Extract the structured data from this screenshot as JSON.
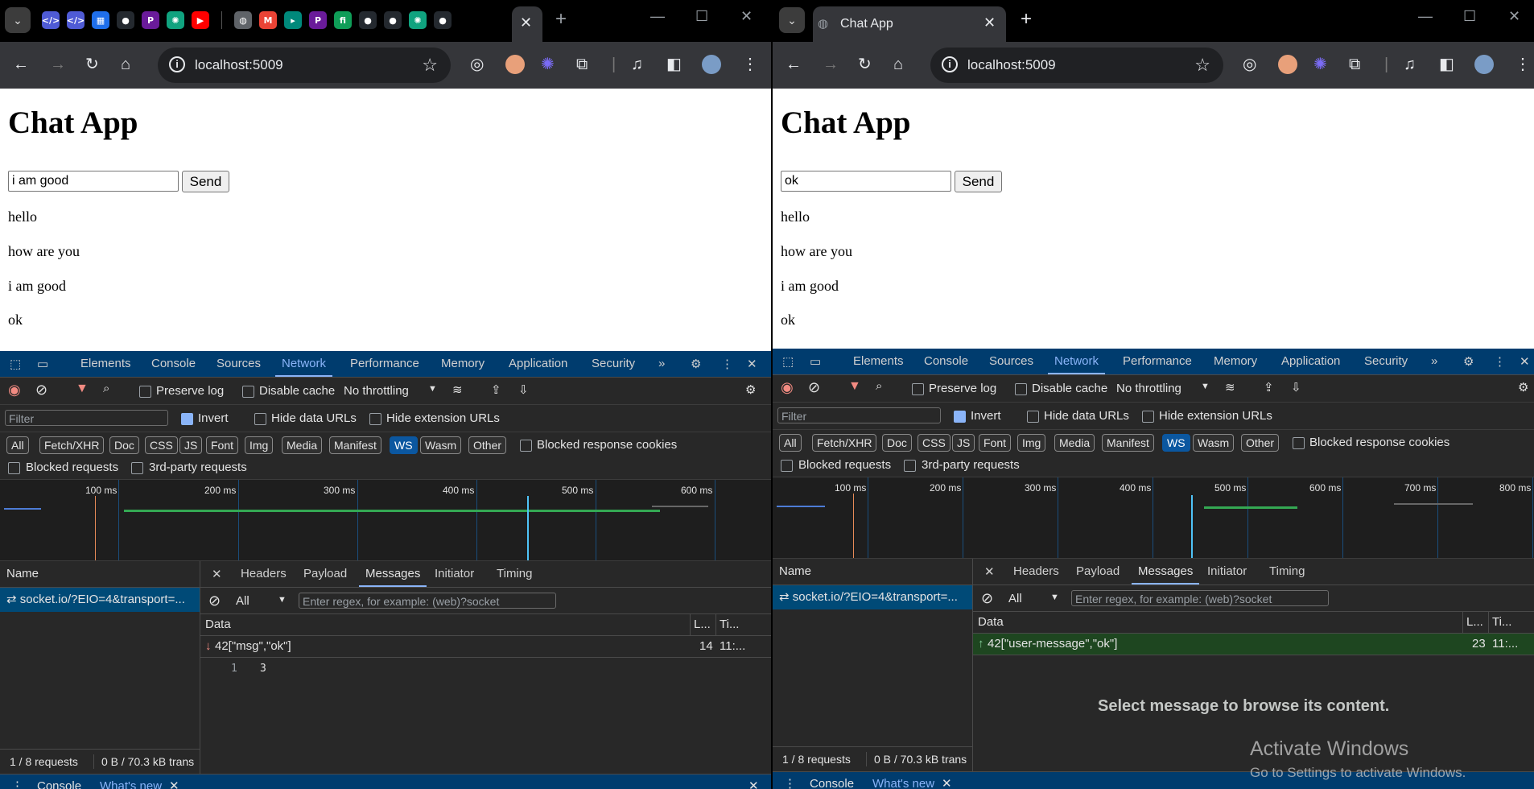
{
  "left": {
    "tab_close": "✕",
    "new_tab": "+",
    "url": "localhost:5009",
    "page": {
      "title": "Chat App",
      "input_value": "i am good",
      "send_label": "Send",
      "messages": [
        "hello",
        "how are you",
        "i am good",
        "ok"
      ]
    },
    "devtools": {
      "tabs": [
        "Elements",
        "Console",
        "Sources",
        "Network",
        "Performance",
        "Memory",
        "Application",
        "Security"
      ],
      "more": "»",
      "preserve_log": "Preserve log",
      "disable_cache": "Disable cache",
      "throttling": "No throttling",
      "filter_placeholder": "Filter",
      "invert": "Invert",
      "hide_data_urls": "Hide data URLs",
      "hide_extension_urls": "Hide extension URLs",
      "types": [
        "All",
        "Fetch/XHR",
        "Doc",
        "CSS",
        "JS",
        "Font",
        "Img",
        "Media",
        "Manifest",
        "WS",
        "Wasm",
        "Other"
      ],
      "blocked_cookies": "Blocked response cookies",
      "blocked_requests": "Blocked requests",
      "third_party": "3rd-party requests",
      "timeline_labels": [
        "100 ms",
        "200 ms",
        "300 ms",
        "400 ms",
        "500 ms",
        "600 ms"
      ],
      "name_header": "Name",
      "request_name": "socket.io/?EIO=4&transport=...",
      "detail_tabs": [
        "Headers",
        "Payload",
        "Messages",
        "Initiator",
        "Timing"
      ],
      "msg_filter_all": "All",
      "msg_filter_placeholder": "Enter regex, for example: (web)?socket",
      "col_data": "Data",
      "col_length": "L...",
      "col_time": "Ti...",
      "message_data": "42[\"msg\",\"ok\"]",
      "message_length": "14",
      "message_time": "11:...",
      "preview_line": "1",
      "preview_value": "3",
      "status_requests": "1 / 8 requests",
      "status_transfer": "0 B / 70.3 kB trans",
      "drawer_console": "Console",
      "drawer_whatsnew": "What's new"
    }
  },
  "right": {
    "tab_title": "Chat App",
    "tab_close": "✕",
    "new_tab": "+",
    "url": "localhost:5009",
    "page": {
      "title": "Chat App",
      "input_value": "ok",
      "send_label": "Send",
      "messages": [
        "hello",
        "how are you",
        "i am good",
        "ok"
      ]
    },
    "devtools": {
      "tabs": [
        "Elements",
        "Console",
        "Sources",
        "Network",
        "Performance",
        "Memory",
        "Application",
        "Security"
      ],
      "more": "»",
      "preserve_log": "Preserve log",
      "disable_cache": "Disable cache",
      "throttling": "No throttling",
      "filter_placeholder": "Filter",
      "invert": "Invert",
      "hide_data_urls": "Hide data URLs",
      "hide_extension_urls": "Hide extension URLs",
      "types": [
        "All",
        "Fetch/XHR",
        "Doc",
        "CSS",
        "JS",
        "Font",
        "Img",
        "Media",
        "Manifest",
        "WS",
        "Wasm",
        "Other"
      ],
      "blocked_cookies": "Blocked response cookies",
      "blocked_requests": "Blocked requests",
      "third_party": "3rd-party requests",
      "timeline_labels": [
        "100 ms",
        "200 ms",
        "300 ms",
        "400 ms",
        "500 ms",
        "600 ms",
        "700 ms",
        "800 ms"
      ],
      "name_header": "Name",
      "request_name": "socket.io/?EIO=4&transport=...",
      "detail_tabs": [
        "Headers",
        "Payload",
        "Messages",
        "Initiator",
        "Timing"
      ],
      "msg_filter_all": "All",
      "msg_filter_placeholder": "Enter regex, for example: (web)?socket",
      "col_data": "Data",
      "col_length": "L...",
      "col_time": "Ti...",
      "message_data": "42[\"user-message\",\"ok\"]",
      "message_length": "23",
      "message_time": "11:...",
      "empty_hint": "Select message to browse its content.",
      "status_requests": "1 / 8 requests",
      "status_transfer": "0 B / 70.3 kB trans",
      "drawer_console": "Console",
      "drawer_whatsnew": "What's new"
    }
  },
  "watermark": {
    "title": "Activate Windows",
    "subtitle": "Go to Settings to activate Windows."
  },
  "colors": {
    "devtools_tabbar": "#003c6e",
    "accent": "#8ab4f8",
    "ws_sent_row": "#1e4620",
    "selected_row": "#004a77"
  }
}
